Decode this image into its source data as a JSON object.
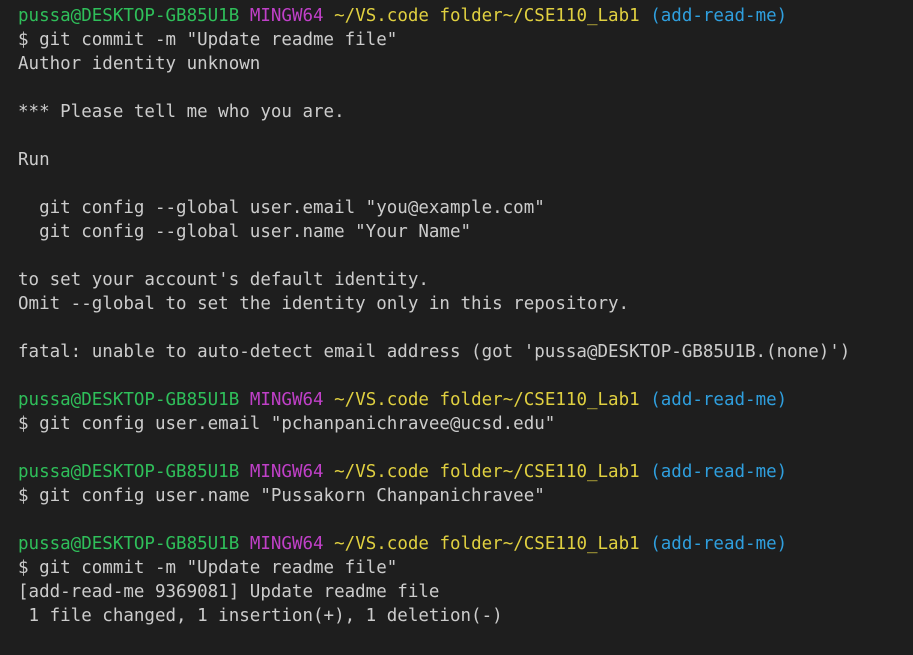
{
  "colors": {
    "background": "#1e1e1e",
    "text": "#cccccc",
    "prompt_user": "#2fbf5a",
    "prompt_system": "#c040c8",
    "prompt_path": "#e0d040",
    "prompt_branch": "#2f9fde"
  },
  "prompt": {
    "user_host": "pussa@DESKTOP-GB85U1B",
    "system": "MINGW64",
    "path": "~/VS.code folder~/CSE110_Lab1",
    "branch": "(add-read-me)"
  },
  "blocks": [
    {
      "command": "$ git commit -m \"Update readme file\"",
      "output": [
        "Author identity unknown",
        "",
        "*** Please tell me who you are.",
        "",
        "Run",
        "",
        "  git config --global user.email \"you@example.com\"",
        "  git config --global user.name \"Your Name\"",
        "",
        "to set your account's default identity.",
        "Omit --global to set the identity only in this repository.",
        "",
        "fatal: unable to auto-detect email address (got 'pussa@DESKTOP-GB85U1B.(none)')",
        ""
      ]
    },
    {
      "command": "$ git config user.email \"pchanpanichravee@ucsd.edu\"",
      "output": [
        ""
      ]
    },
    {
      "command": "$ git config user.name \"Pussakorn Chanpanichravee\"",
      "output": [
        ""
      ]
    },
    {
      "command": "$ git commit -m \"Update readme file\"",
      "output": [
        "[add-read-me 9369081] Update readme file",
        " 1 file changed, 1 insertion(+), 1 deletion(-)"
      ]
    }
  ]
}
